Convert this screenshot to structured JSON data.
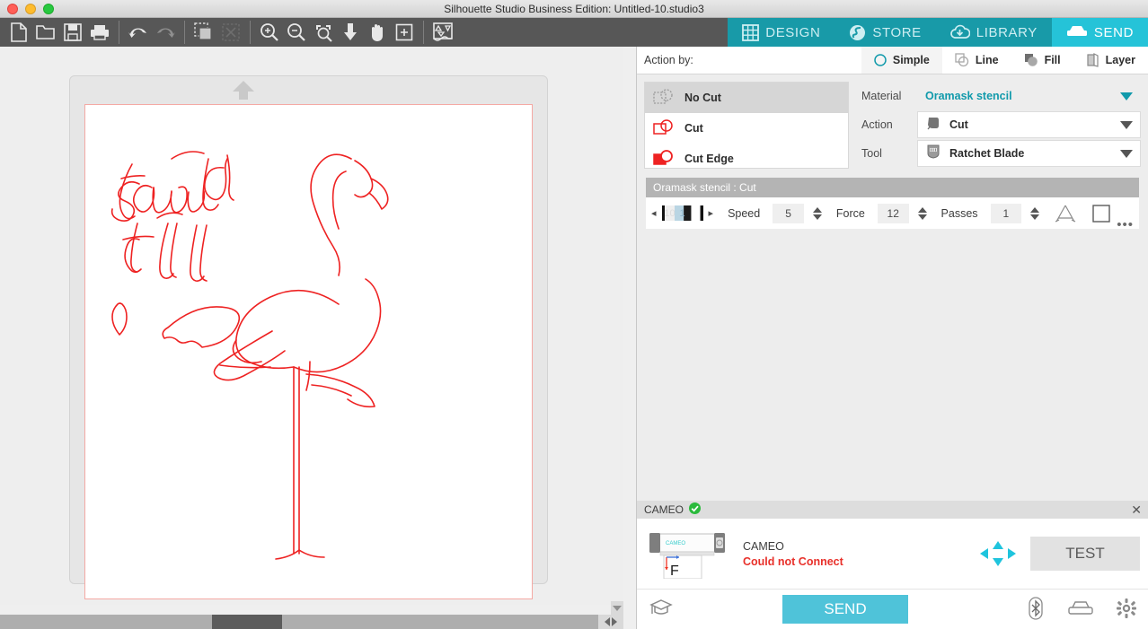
{
  "window": {
    "title": "Silhouette Studio Business Edition: Untitled-10.studio3",
    "controls": {
      "close": "close-button",
      "minimize": "minimize-button",
      "zoom": "zoom-button"
    }
  },
  "toolbar": {
    "items": [
      {
        "name": "new-document",
        "label": "New"
      },
      {
        "name": "open-document",
        "label": "Open"
      },
      {
        "name": "save-document",
        "label": "Save"
      },
      {
        "name": "print-document",
        "label": "Print"
      },
      {
        "name": "undo",
        "label": "Undo"
      },
      {
        "name": "redo",
        "label": "Redo"
      },
      {
        "name": "copy-selection",
        "label": "Copy"
      },
      {
        "name": "delete-selection",
        "label": "Delete"
      },
      {
        "name": "zoom-in",
        "label": "Zoom In"
      },
      {
        "name": "zoom-out",
        "label": "Zoom Out"
      },
      {
        "name": "zoom-selection",
        "label": "Zoom to Selection"
      },
      {
        "name": "fit-to-window",
        "label": "Fit to Window"
      },
      {
        "name": "pan-tool",
        "label": "Pan"
      },
      {
        "name": "zoom-region",
        "label": "Zoom Region"
      },
      {
        "name": "preview-panel",
        "label": "Cut Preview"
      }
    ]
  },
  "mainnav": {
    "items": [
      {
        "label": "DESIGN",
        "icon": "grid-icon",
        "active": false
      },
      {
        "label": "STORE",
        "icon": "store-icon",
        "active": false
      },
      {
        "label": "LIBRARY",
        "icon": "cloud-download-icon",
        "active": false
      },
      {
        "label": "SEND",
        "icon": "cutter-icon",
        "active": true
      }
    ]
  },
  "canvas": {
    "orientation_icon": "up-arrow-icon",
    "artwork_color": "#ee2222",
    "artwork_items": [
      "stand-tall-lettering",
      "flamingo-outline",
      "small-leaf-shape",
      "wing-shape"
    ],
    "page_border_color": "#f4a9a4",
    "scrollbars": {
      "vertical": "vertical-scrollbar",
      "horizontal": "horizontal-scrollbar"
    }
  },
  "send_panel": {
    "action_by": {
      "label": "Action by:",
      "tabs": [
        {
          "label": "Simple",
          "icon": "circle-icon",
          "active": true
        },
        {
          "label": "Line",
          "icon": "line-layers-icon",
          "active": false
        },
        {
          "label": "Fill",
          "icon": "fill-icon",
          "active": false
        },
        {
          "label": "Layer",
          "icon": "layer-icon",
          "active": false
        }
      ]
    },
    "cut_options": [
      {
        "label": "No Cut",
        "icon": "no-cut-icon",
        "selected": true
      },
      {
        "label": "Cut",
        "icon": "cut-icon",
        "selected": false
      },
      {
        "label": "Cut Edge",
        "icon": "cut-edge-icon",
        "selected": false
      }
    ],
    "settings": [
      {
        "label": "Material",
        "value": "Oramask stencil",
        "icon": null,
        "accent": true
      },
      {
        "label": "Action",
        "value": "Cut",
        "icon": "blade-icon",
        "accent": false
      },
      {
        "label": "Tool",
        "value": "Ratchet Blade",
        "icon": "ratchet-blade-icon",
        "accent": false
      }
    ],
    "accent_color": "#119aab",
    "cut_header": "Oramask stencil : Cut",
    "blade_depth": {
      "left_arrow": "◂",
      "right_arrow": "▸",
      "ticks": [
        "10",
        "1",
        "2"
      ]
    },
    "params": [
      {
        "label": "Speed",
        "value": "5"
      },
      {
        "label": "Force",
        "value": "12"
      },
      {
        "label": "Passes",
        "value": "1"
      }
    ],
    "extra_icons": [
      {
        "name": "overcut-icon"
      },
      {
        "name": "square-tool-icon"
      },
      {
        "name": "more-options-icon",
        "label": "•••"
      }
    ]
  },
  "device": {
    "header_label": "CAMEO",
    "header_status_icon": "green-check-icon",
    "close_label": "✕",
    "name": "CAMEO",
    "status": "Could not Connect",
    "status_color": "#e8302a",
    "thumbnail_icon": "cameo-machine-icon",
    "dpad_icon": "dpad-arrows-icon",
    "test_button": "TEST"
  },
  "footer": {
    "graduation_icon": "graduation-cap-icon",
    "send_button": "SEND",
    "send_color": "#4fc3d9",
    "right_icons": [
      {
        "name": "bluetooth-icon"
      },
      {
        "name": "cutter-machine-icon"
      },
      {
        "name": "settings-gear-icon"
      }
    ]
  }
}
